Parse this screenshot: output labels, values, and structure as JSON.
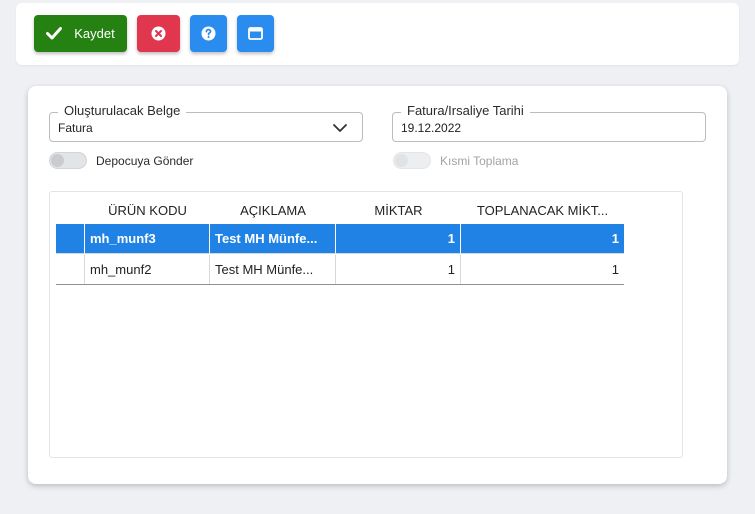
{
  "toolbar": {
    "save_label": "Kaydet",
    "colors": {
      "save": "#258212",
      "cancel": "#e0364e",
      "help": "#2a8cef"
    }
  },
  "form": {
    "belge": {
      "label": "Oluşturulacak Belge",
      "value": "Fatura"
    },
    "tarih": {
      "label": "Fatura/Irsaliye Tarihi",
      "value": "19.12.2022"
    },
    "depocuya_label": "Depocuya Gönder",
    "kismi_label": "Kısmi Toplama"
  },
  "grid": {
    "columns": [
      "ÜRÜN KODU",
      "AÇIKLAMA",
      "MİKTAR",
      "TOPLANACAK MİKT..."
    ],
    "rows": [
      {
        "urun_kodu": "mh_munf3",
        "aciklama": "Test MH Münfe...",
        "miktar": "1",
        "toplanacak": "1",
        "selected": true
      },
      {
        "urun_kodu": "mh_munf2",
        "aciklama": "Test MH Münfe...",
        "miktar": "1",
        "toplanacak": "1",
        "selected": false
      }
    ],
    "selected_color": "#2182e6"
  }
}
